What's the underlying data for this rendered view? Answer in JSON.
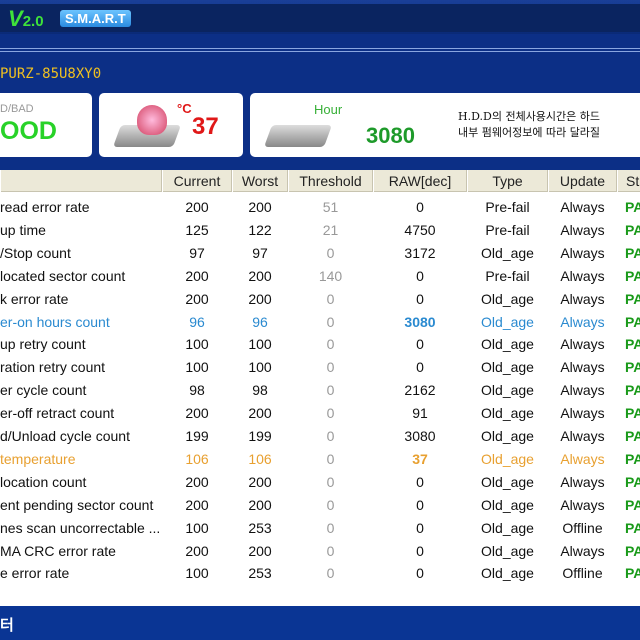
{
  "header": {
    "version": "V",
    "version_num": "2.0",
    "badge": "S.M.A.R.T"
  },
  "model": "PURZ-85U8XY0",
  "cards": {
    "status_label": "D/BAD",
    "status_value": "OOD",
    "temp_unit": "°C",
    "temp_value": "37",
    "hour_label": "Hour",
    "hour_value": "3080",
    "note_line1": "H.D.D의 전체사용시간은 하드",
    "note_line2": "내부 펌웨어정보에 따라 달라질"
  },
  "colors": {
    "good": "#28d228",
    "temp": "#e01818",
    "highlight_blue": "#2a8ad0",
    "highlight_orange": "#e8a030",
    "pass": "#1a9a1a"
  },
  "table": {
    "columns": [
      "",
      "Current",
      "Worst",
      "Threshold",
      "RAW[dec]",
      "Type",
      "Update",
      "St"
    ],
    "rows": [
      {
        "name": "read error rate",
        "cur": "200",
        "worst": "200",
        "thr": "51",
        "raw": "0",
        "type": "Pre-fail",
        "upd": "Always",
        "st": "PA"
      },
      {
        "name": "up time",
        "cur": "125",
        "worst": "122",
        "thr": "21",
        "raw": "4750",
        "type": "Pre-fail",
        "upd": "Always",
        "st": "PA"
      },
      {
        "name": "/Stop count",
        "cur": "97",
        "worst": "97",
        "thr": "0",
        "raw": "3172",
        "type": "Old_age",
        "upd": "Always",
        "st": "PA"
      },
      {
        "name": "located sector count",
        "cur": "200",
        "worst": "200",
        "thr": "140",
        "raw": "0",
        "type": "Pre-fail",
        "upd": "Always",
        "st": "PA"
      },
      {
        "name": "k error rate",
        "cur": "200",
        "worst": "200",
        "thr": "0",
        "raw": "0",
        "type": "Old_age",
        "upd": "Always",
        "st": "PA"
      },
      {
        "name": "er-on hours count",
        "cur": "96",
        "worst": "96",
        "thr": "0",
        "raw": "3080",
        "type": "Old_age",
        "upd": "Always",
        "st": "PA",
        "hl": "blue"
      },
      {
        "name": "up retry count",
        "cur": "100",
        "worst": "100",
        "thr": "0",
        "raw": "0",
        "type": "Old_age",
        "upd": "Always",
        "st": "PA"
      },
      {
        "name": "ration retry count",
        "cur": "100",
        "worst": "100",
        "thr": "0",
        "raw": "0",
        "type": "Old_age",
        "upd": "Always",
        "st": "PA"
      },
      {
        "name": "er cycle count",
        "cur": "98",
        "worst": "98",
        "thr": "0",
        "raw": "2162",
        "type": "Old_age",
        "upd": "Always",
        "st": "PA"
      },
      {
        "name": "er-off retract count",
        "cur": "200",
        "worst": "200",
        "thr": "0",
        "raw": "91",
        "type": "Old_age",
        "upd": "Always",
        "st": "PA"
      },
      {
        "name": "d/Unload cycle count",
        "cur": "199",
        "worst": "199",
        "thr": "0",
        "raw": "3080",
        "type": "Old_age",
        "upd": "Always",
        "st": "PA"
      },
      {
        "name": "temperature",
        "cur": "106",
        "worst": "106",
        "thr": "0",
        "raw": "37",
        "type": "Old_age",
        "upd": "Always",
        "st": "PA",
        "hl": "orange"
      },
      {
        "name": "location count",
        "cur": "200",
        "worst": "200",
        "thr": "0",
        "raw": "0",
        "type": "Old_age",
        "upd": "Always",
        "st": "PA"
      },
      {
        "name": "ent pending sector count",
        "cur": "200",
        "worst": "200",
        "thr": "0",
        "raw": "0",
        "type": "Old_age",
        "upd": "Always",
        "st": "PA"
      },
      {
        "name": "nes scan uncorrectable ...",
        "cur": "100",
        "worst": "253",
        "thr": "0",
        "raw": "0",
        "type": "Old_age",
        "upd": "Offline",
        "st": "PA"
      },
      {
        "name": "MA CRC error rate",
        "cur": "200",
        "worst": "200",
        "thr": "0",
        "raw": "0",
        "type": "Old_age",
        "upd": "Always",
        "st": "PA"
      },
      {
        "name": "e error rate",
        "cur": "100",
        "worst": "253",
        "thr": "0",
        "raw": "0",
        "type": "Old_age",
        "upd": "Offline",
        "st": "PA"
      }
    ]
  },
  "footer": {
    "text": "터"
  }
}
